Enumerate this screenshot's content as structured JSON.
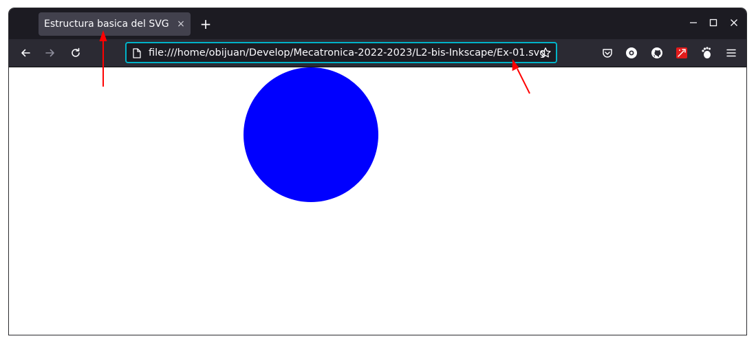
{
  "tab": {
    "title": "Estructura basica del SVG",
    "close": "×"
  },
  "new_tab": "+",
  "window_controls": {
    "minimize": "—",
    "maximize": "☐",
    "close": "✕"
  },
  "urlbar": {
    "value": "file:///home/obijuan/Develop/Mecatronica-2022-2023/L2-bis-Inkscape/Ex-01.svg"
  },
  "content": {
    "circle_color": "#0000ff"
  },
  "colors": {
    "titlebar": "#1c1b22",
    "navbar": "#2b2a33",
    "urlbar_focus": "#00b3c8",
    "annotation_arrow": "#ff0000"
  },
  "icons": [
    "back-icon",
    "forward-icon",
    "reload-icon",
    "page-icon",
    "bookmark-star-icon",
    "pocket-icon",
    "extension-icon",
    "github-icon",
    "extension-icon-red",
    "gnome-foot-icon",
    "menu-icon"
  ]
}
